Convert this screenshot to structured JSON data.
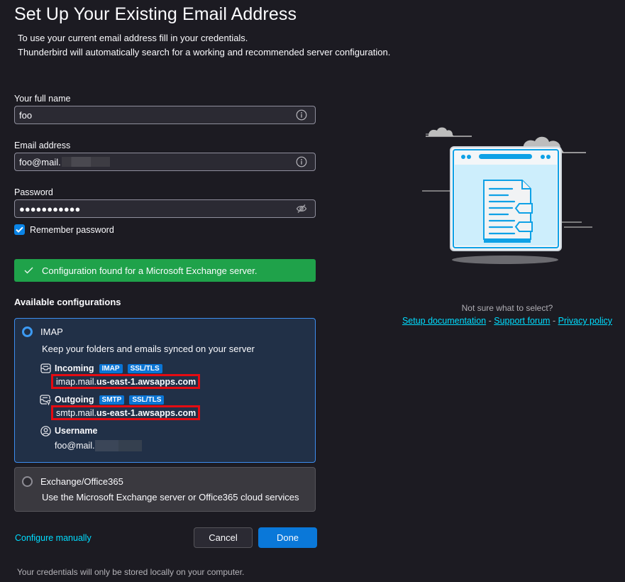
{
  "header": {
    "title": "Set Up Your Existing Email Address",
    "description_line1": "To use your current email address fill in your credentials.",
    "description_line2": "Thunderbird will automatically search for a working and recommended server configuration."
  },
  "form": {
    "full_name": {
      "label": "Your full name",
      "value": "foo",
      "icon": "info-icon"
    },
    "email": {
      "label": "Email address",
      "value": "foo@mail.",
      "redacted": true,
      "icon": "info-icon"
    },
    "password": {
      "label": "Password",
      "value_masked": "●●●●●●●●●●●",
      "length": 11,
      "icon": "eye-slash-icon"
    },
    "remember_password": {
      "label": "Remember password",
      "checked": true
    }
  },
  "status_banner": {
    "text": "Configuration found for a Microsoft Exchange server.",
    "icon": "checkmark-icon",
    "color": "#1fa24a"
  },
  "configurations": {
    "heading": "Available configurations",
    "options": [
      {
        "name": "IMAP",
        "selected": true,
        "description": "Keep your folders and emails synced on your server",
        "incoming": {
          "label": "Incoming",
          "tags": [
            "IMAP",
            "SSL/TLS"
          ],
          "host_prefix": "imap.mail.",
          "host_bold": "us-east-1.awsapps.com"
        },
        "outgoing": {
          "label": "Outgoing",
          "tags": [
            "SMTP",
            "SSL/TLS"
          ],
          "host_prefix": "smtp.mail.",
          "host_bold": "us-east-1.awsapps.com"
        },
        "username": {
          "label": "Username",
          "value": "foo@mail.",
          "redacted": true
        }
      },
      {
        "name": "Exchange/Office365",
        "selected": false,
        "description": "Use the Microsoft Exchange server or Office365 cloud services"
      }
    ]
  },
  "actions": {
    "configure_manually": "Configure manually",
    "cancel": "Cancel",
    "done": "Done"
  },
  "footnote": "Your credentials will only be stored locally on your computer.",
  "help": {
    "question": "Not sure what to select?",
    "links": [
      "Setup documentation",
      "Support forum",
      "Privacy policy"
    ],
    "separator": "-"
  },
  "colors": {
    "background": "#1c1b22",
    "accent": "#0a78d9",
    "link": "#00ddff",
    "highlight_box": "#e50b12",
    "selected_card": "#213047"
  }
}
